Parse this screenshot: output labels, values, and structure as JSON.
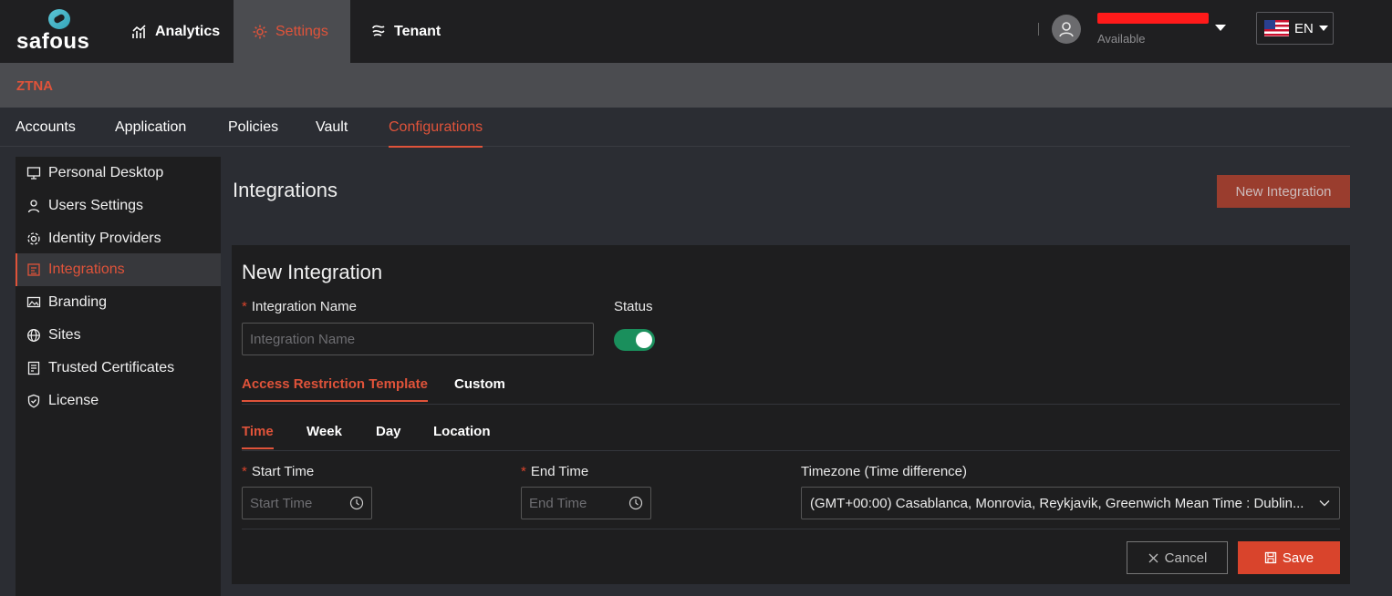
{
  "brand": {
    "logo_text": "safous",
    "accent": "#e0533a"
  },
  "topnav": {
    "items": [
      {
        "label": "Analytics",
        "icon": "analytics-icon"
      },
      {
        "label": "Settings",
        "icon": "gear-icon",
        "active": true
      },
      {
        "label": "Tenant",
        "icon": "tenant-icon"
      }
    ]
  },
  "user": {
    "status": "Available"
  },
  "language": {
    "code": "EN",
    "flag": "us-flag-icon"
  },
  "breadcrumb": {
    "section": "ZTNA"
  },
  "maintabs": [
    {
      "label": "Accounts"
    },
    {
      "label": "Application"
    },
    {
      "label": "Policies"
    },
    {
      "label": "Vault"
    },
    {
      "label": "Configurations",
      "active": true
    }
  ],
  "sidebar": {
    "items": [
      {
        "label": "Personal Desktop",
        "icon": "monitor-icon"
      },
      {
        "label": "Users Settings",
        "icon": "user-icon"
      },
      {
        "label": "Identity Providers",
        "icon": "gear-icon"
      },
      {
        "label": "Integrations",
        "icon": "integration-icon",
        "active": true
      },
      {
        "label": "Branding",
        "icon": "image-icon"
      },
      {
        "label": "Sites",
        "icon": "globe-icon"
      },
      {
        "label": "Trusted Certificates",
        "icon": "certificate-icon"
      },
      {
        "label": "License",
        "icon": "shield-check-icon"
      }
    ]
  },
  "main": {
    "title": "Integrations",
    "new_button": "New Integration"
  },
  "form": {
    "title": "New Integration",
    "name_label": "Integration Name",
    "name_placeholder": "Integration Name",
    "status_label": "Status",
    "status_on": true,
    "template_tabs": [
      {
        "label": "Access Restriction Template",
        "active": true
      },
      {
        "label": "Custom"
      }
    ],
    "restriction_tabs": [
      {
        "label": "Time",
        "active": true
      },
      {
        "label": "Week"
      },
      {
        "label": "Day"
      },
      {
        "label": "Location"
      }
    ],
    "start_label": "Start Time",
    "start_placeholder": "Start Time",
    "end_label": "End Time",
    "end_placeholder": "End Time",
    "timezone_label": "Timezone (Time difference)",
    "timezone_value": "(GMT+00:00) Casablanca, Monrovia, Reykjavik, Greenwich Mean Time : Dublin...",
    "cancel_label": "Cancel",
    "save_label": "Save"
  }
}
